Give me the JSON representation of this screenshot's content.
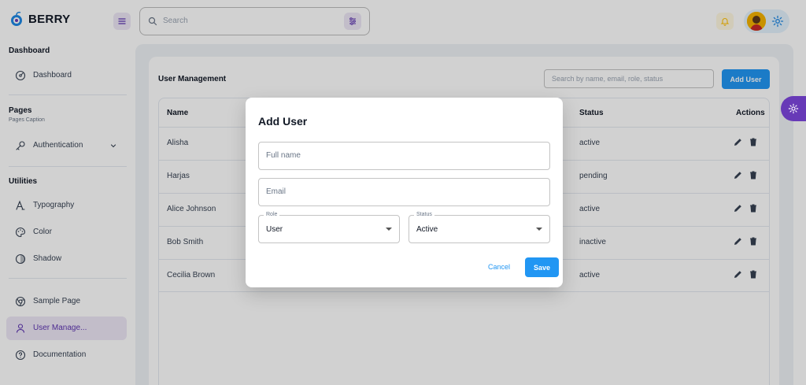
{
  "brand": {
    "name": "BERRY"
  },
  "header": {
    "search_placeholder": "Search"
  },
  "sidebar": {
    "sections": [
      {
        "title": "Dashboard",
        "caption": ""
      },
      {
        "title": "Pages",
        "caption": "Pages Caption"
      },
      {
        "title": "Utilities",
        "caption": ""
      }
    ],
    "items": [
      {
        "label": "Dashboard",
        "icon": "dashboard-icon"
      },
      {
        "label": "Authentication",
        "icon": "key-icon"
      },
      {
        "label": "Typography",
        "icon": "typography-icon"
      },
      {
        "label": "Color",
        "icon": "palette-icon"
      },
      {
        "label": "Shadow",
        "icon": "shadow-icon"
      },
      {
        "label": "Sample Page",
        "icon": "brand-chrome-icon"
      },
      {
        "label": "User Manage...",
        "icon": "user-icon",
        "active": true
      },
      {
        "label": "Documentation",
        "icon": "help-icon"
      }
    ]
  },
  "main": {
    "title": "User Management",
    "search_placeholder": "Search by name, email, role, status",
    "add_user_label": "Add User",
    "table": {
      "columns": [
        "Name",
        "Status",
        "Actions"
      ],
      "rows": [
        {
          "name": "Alisha",
          "status": "active"
        },
        {
          "name": "Harjas",
          "status": "pending"
        },
        {
          "name": "Alice Johnson",
          "status": "active"
        },
        {
          "name": "Bob Smith",
          "status": "inactive"
        },
        {
          "name": "Cecilia Brown",
          "status": "active"
        }
      ]
    }
  },
  "dialog": {
    "title": "Add User",
    "full_name_placeholder": "Full name",
    "email_placeholder": "Email",
    "role_label": "Role",
    "role_value": "User",
    "status_label": "Status",
    "status_value": "Active",
    "cancel_label": "Cancel",
    "save_label": "Save"
  },
  "colors": {
    "primary": "#2196f3",
    "secondary": "#673ab7",
    "secondary_light": "#ede7f6",
    "page_bg": "#eef2f6"
  }
}
